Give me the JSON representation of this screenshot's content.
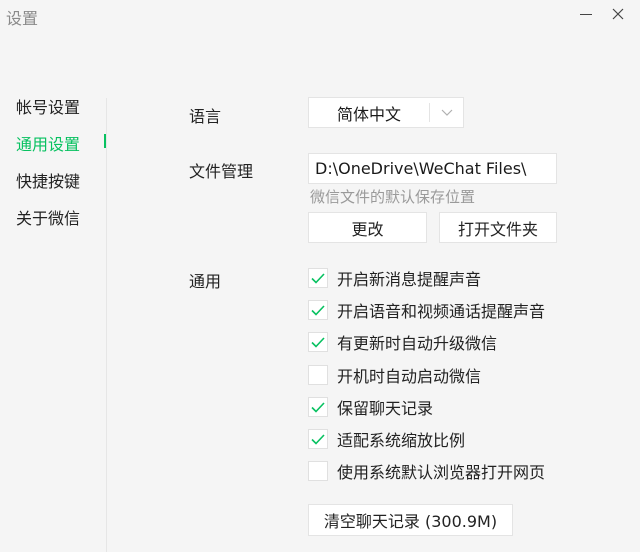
{
  "window": {
    "title": "设置"
  },
  "sidebar": {
    "items": [
      {
        "label": "帐号设置",
        "active": false
      },
      {
        "label": "通用设置",
        "active": true
      },
      {
        "label": "快捷按键",
        "active": false
      },
      {
        "label": "关于微信",
        "active": false
      }
    ]
  },
  "language": {
    "label": "语言",
    "selected": "简体中文"
  },
  "file_management": {
    "label": "文件管理",
    "path": "D:\\OneDrive\\WeChat Files\\",
    "hint": "微信文件的默认保存位置",
    "change_button": "更改",
    "open_folder_button": "打开文件夹"
  },
  "general": {
    "label": "通用",
    "options": [
      {
        "label": "开启新消息提醒声音",
        "checked": true
      },
      {
        "label": "开启语音和视频通话提醒声音",
        "checked": true
      },
      {
        "label": "有更新时自动升级微信",
        "checked": true
      },
      {
        "label": "开机时自动启动微信",
        "checked": false
      },
      {
        "label": "保留聊天记录",
        "checked": true
      },
      {
        "label": "适配系统缩放比例",
        "checked": true
      },
      {
        "label": "使用系统默认浏览器打开网页",
        "checked": false
      }
    ],
    "clear_history_button": "清空聊天记录 (300.9M)"
  },
  "colors": {
    "accent": "#07c160",
    "background": "#f5f5f5"
  },
  "icons": {
    "check": "check-icon",
    "dropdown": "chevron-down-icon",
    "minimize": "minimize-icon",
    "close": "close-icon"
  }
}
